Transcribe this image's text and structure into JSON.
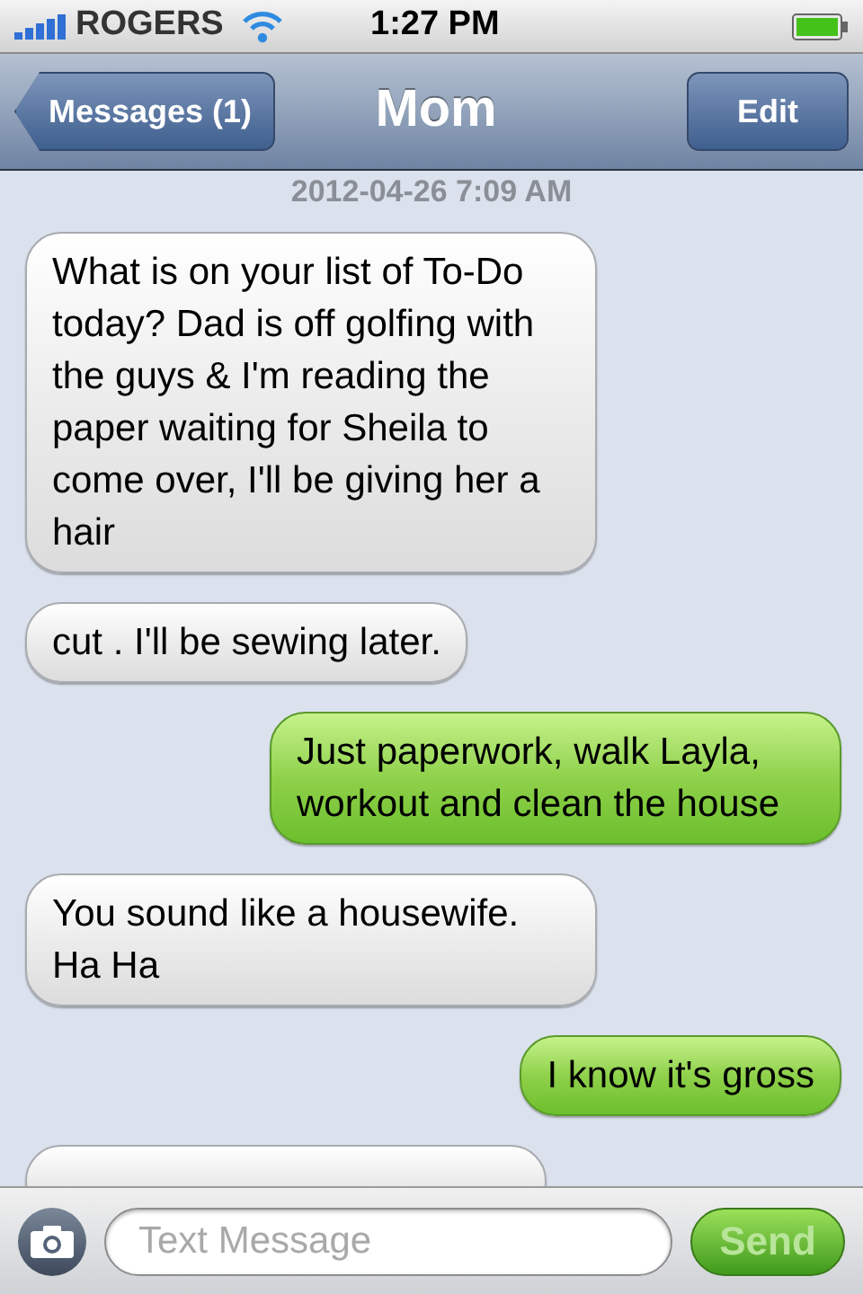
{
  "status_bar": {
    "carrier": "ROGERS",
    "time": "1:27 PM"
  },
  "nav": {
    "back": "Messages (1)",
    "title": "Mom",
    "edit": "Edit"
  },
  "timestamp": "2012-04-26 7:09 AM",
  "messages": [
    {
      "kind": "received",
      "text": "What is on your list of To-Do today? Dad is off golfing with the guys & I'm reading the paper waiting for Sheila to come over, I'll be giving her a hair"
    },
    {
      "kind": "received",
      "text": "cut . I'll be sewing later."
    },
    {
      "kind": "sent",
      "text": "Just paperwork, walk Layla, workout and clean the house"
    },
    {
      "kind": "received",
      "text": "You sound like a housewife. Ha Ha"
    },
    {
      "kind": "sent",
      "text": "I know it's gross"
    },
    {
      "kind": "received"
    }
  ],
  "composer": {
    "placeholder": "Text Message",
    "send": "Send",
    "send_disabled": true
  }
}
